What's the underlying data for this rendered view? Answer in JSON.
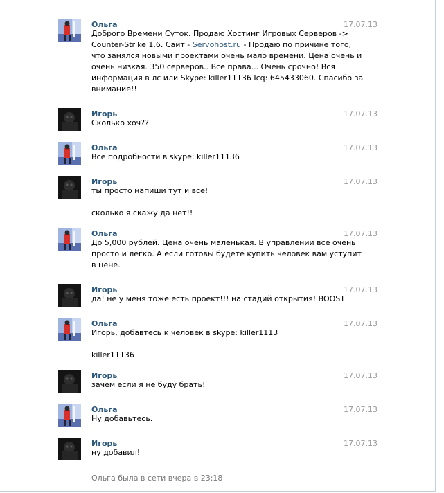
{
  "conversation": {
    "messages": [
      {
        "author": "Ольга",
        "date": "17.07.13",
        "lines": [
          [
            "Доброго Времени Суток. Продаю Хостинг Игровых Серверов ->"
          ],
          [
            "Counter-Strike 1.6. Сайт - ",
            {
              "link": "Servohost.ru"
            },
            " - Продаю по причине того,"
          ],
          [
            "что занялся новыми проектами очень мало времени. Цена очень и"
          ],
          [
            "очень низкая. 350 серверов.. Все права... Очень срочно! Вся"
          ],
          [
            "информация в лс или Skype: killer11136 Icq: 645433060. Спасибо за"
          ],
          [
            "внимание!!"
          ]
        ]
      },
      {
        "author": "Игорь",
        "date": "17.07.13",
        "lines": [
          [
            "Сколько хоч??"
          ]
        ]
      },
      {
        "author": "Ольга",
        "date": "17.07.13",
        "lines": [
          [
            "Все подробности в skype: killer11136"
          ]
        ]
      },
      {
        "author": "Игорь",
        "date": "17.07.13",
        "lines": [
          [
            "ты просто напиши тут и все!"
          ],
          [
            ""
          ],
          [
            "сколько я скажу да нет!!"
          ]
        ]
      },
      {
        "author": "Ольга",
        "date": "17.07.13",
        "lines": [
          [
            "До 5,000 рублей. Цена очень маленькая. В управлении всё очень"
          ],
          [
            "просто и легко. А если готовы будете купить человек вам уступит"
          ],
          [
            "в цене."
          ]
        ]
      },
      {
        "author": "Игорь",
        "date": "17.07.13",
        "lines": [
          [
            "да! не у меня тоже есть проект!!! на стадий открытия! BOOST"
          ]
        ]
      },
      {
        "author": "Ольга",
        "date": "17.07.13",
        "lines": [
          [
            "Игорь, добавтесь к человек в skype: killer1113"
          ],
          [
            ""
          ],
          [
            "killer11136"
          ]
        ]
      },
      {
        "author": "Игорь",
        "date": "17.07.13",
        "lines": [
          [
            "зачем если я не буду брать!"
          ]
        ]
      },
      {
        "author": "Ольга",
        "date": "17.07.13",
        "lines": [
          [
            "Ну добавьтесь."
          ]
        ]
      },
      {
        "author": "Игорь",
        "date": "17.07.13",
        "lines": [
          [
            "ну добавил!"
          ]
        ]
      }
    ],
    "status_text": "Ольга была в сети вчера в 23:18"
  },
  "avatars": {
    "Ольга": "avatar-olga",
    "Игорь": "avatar-igor"
  },
  "colors": {
    "author": "#2b587a",
    "link": "#2b587a",
    "date": "#999999",
    "status": "#777777"
  }
}
